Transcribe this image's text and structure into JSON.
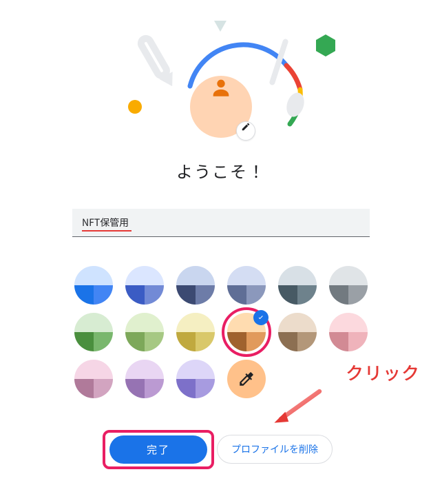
{
  "welcome_text": "ようこそ！",
  "profile_name": {
    "value": "NFT保管用"
  },
  "themes": [
    {
      "top": "#cfe3ff",
      "bl": "#1a73e8",
      "br": "#4285f4"
    },
    {
      "top": "#dbe6ff",
      "bl": "#3b5cc4",
      "br": "#728ad6"
    },
    {
      "top": "#c9d6ef",
      "bl": "#3c4a72",
      "br": "#6d7ca8"
    },
    {
      "top": "#d4ddf3",
      "bl": "#5f6e96",
      "br": "#8b98bc"
    },
    {
      "top": "#d8e0e6",
      "bl": "#475a64",
      "br": "#6e828c"
    },
    {
      "top": "#e0e4e7",
      "bl": "#727a80",
      "br": "#9aa0a6"
    },
    {
      "top": "#d7ecd2",
      "bl": "#4a8f3e",
      "br": "#79b76d"
    },
    {
      "top": "#e0f0ce",
      "bl": "#7da85a",
      "br": "#a6c883"
    },
    {
      "top": "#f5efc2",
      "bl": "#c0a93f",
      "br": "#d9c86a"
    },
    {
      "top": "#ffdcb0",
      "bl": "#a0622e",
      "br": "#e19a5c",
      "selected": true
    },
    {
      "top": "#ecdccb",
      "bl": "#8c6f52",
      "br": "#b39779"
    },
    {
      "top": "#fcd9de",
      "bl": "#d28a94",
      "br": "#efb3bb"
    },
    {
      "top": "#f6d6e6",
      "bl": "#b07a9a",
      "br": "#d2a4c0"
    },
    {
      "top": "#e9d6f3",
      "bl": "#9673b3",
      "br": "#bb9ad2"
    },
    {
      "top": "#ddd6f8",
      "bl": "#7d70c9",
      "br": "#a79be0"
    }
  ],
  "eyedropper_icon": "eyedropper",
  "buttons": {
    "done_label": "完了",
    "delete_profile_label": "プロファイルを削除"
  },
  "annotation": {
    "click_label": "クリック"
  },
  "colors": {
    "accent": "#1a73e8",
    "highlight": "#e91e63",
    "danger": "#e53935"
  }
}
